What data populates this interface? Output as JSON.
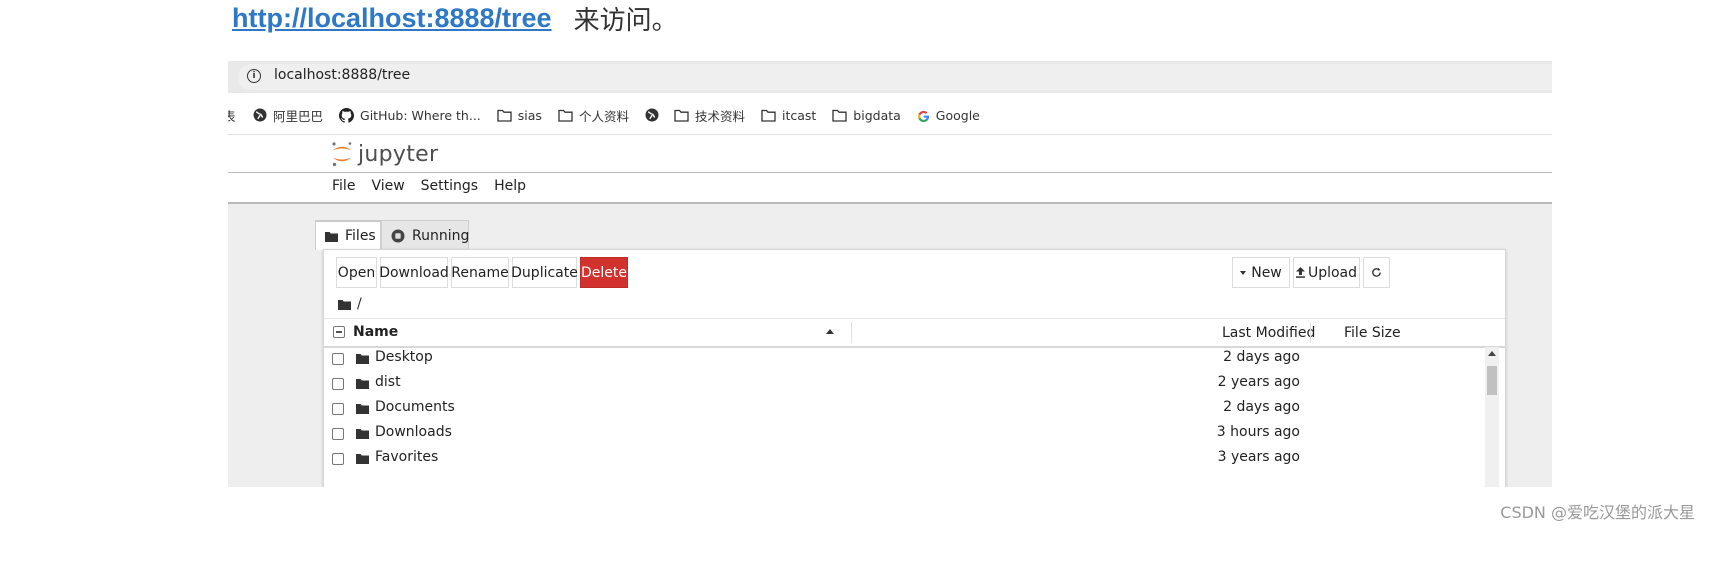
{
  "intro": {
    "link_text": "http://localhost:8888/tree",
    "suffix": "来访问。"
  },
  "browser": {
    "address": "localhost:8888/tree",
    "bookmarks": [
      {
        "label": "表",
        "icon": "globe-icon"
      },
      {
        "label": "阿里巴巴",
        "icon": "globe-icon"
      },
      {
        "label": "GitHub: Where th...",
        "icon": "github-icon"
      },
      {
        "label": "sias",
        "icon": "folder-icon"
      },
      {
        "label": "个人资料",
        "icon": "folder-icon"
      },
      {
        "label": "",
        "icon": "globe-icon"
      },
      {
        "label": "技术资料",
        "icon": "folder-icon"
      },
      {
        "label": "itcast",
        "icon": "folder-icon"
      },
      {
        "label": "bigdata",
        "icon": "folder-icon"
      },
      {
        "label": "Google",
        "icon": "google-icon"
      }
    ]
  },
  "jupyter": {
    "logo_text": "jupyter",
    "menu": [
      "File",
      "View",
      "Settings",
      "Help"
    ],
    "tabs": [
      {
        "label": "Files",
        "active": true
      },
      {
        "label": "Running",
        "active": false
      }
    ],
    "toolbar": {
      "open": "Open",
      "download": "Download",
      "rename": "Rename",
      "duplicate": "Duplicate",
      "delete": "Delete",
      "new": "New",
      "upload": "Upload"
    },
    "breadcrumb": "/",
    "columns": {
      "name": "Name",
      "modified": "Last Modified",
      "size": "File Size"
    },
    "rows": [
      {
        "name": "Desktop",
        "modified": "2 days ago"
      },
      {
        "name": "dist",
        "modified": "2 years ago"
      },
      {
        "name": "Documents",
        "modified": "2 days ago"
      },
      {
        "name": "Downloads",
        "modified": "3 hours ago"
      },
      {
        "name": "Favorites",
        "modified": "3 years ago"
      }
    ]
  },
  "watermark": "CSDN @爱吃汉堡的派大星",
  "colors": {
    "link": "#2f78c5",
    "delete": "#d2322d",
    "workspace": "#eeeeee"
  }
}
